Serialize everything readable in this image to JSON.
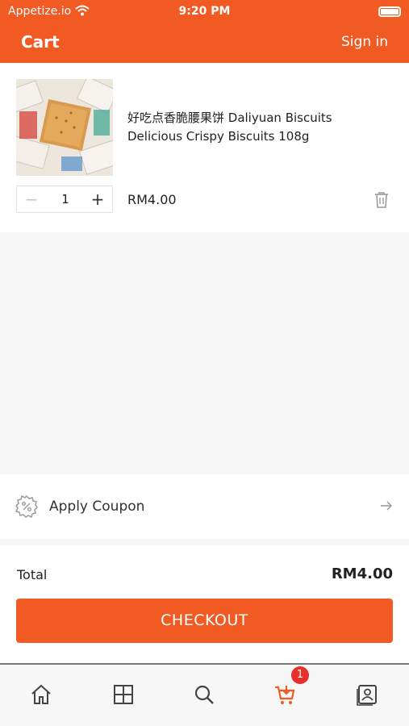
{
  "status_bar": {
    "carrier": "Appetize.io",
    "time": "9:20 PM"
  },
  "header": {
    "title": "Cart",
    "sign_in": "Sign in"
  },
  "cart": {
    "items": [
      {
        "name": "好吃点香脆腰果饼 Daliyuan Biscuits Delicious Crispy Biscuits 108g",
        "quantity": "1",
        "price": "RM4.00",
        "minus_symbol": "−",
        "plus_symbol": "+"
      }
    ]
  },
  "coupon": {
    "label": "Apply Coupon"
  },
  "summary": {
    "total_label": "Total",
    "total_value": "RM4.00",
    "checkout_label": "CHECKOUT"
  },
  "tabbar": {
    "items": [
      {
        "icon": "home-icon"
      },
      {
        "icon": "grid-icon"
      },
      {
        "icon": "search-icon"
      },
      {
        "icon": "cart-icon",
        "active": true
      },
      {
        "icon": "profile-icon"
      }
    ],
    "cart_badge": "1"
  },
  "colors": {
    "brand": "#f25a24",
    "badge": "#e8302a",
    "background": "#f7f7f7"
  }
}
